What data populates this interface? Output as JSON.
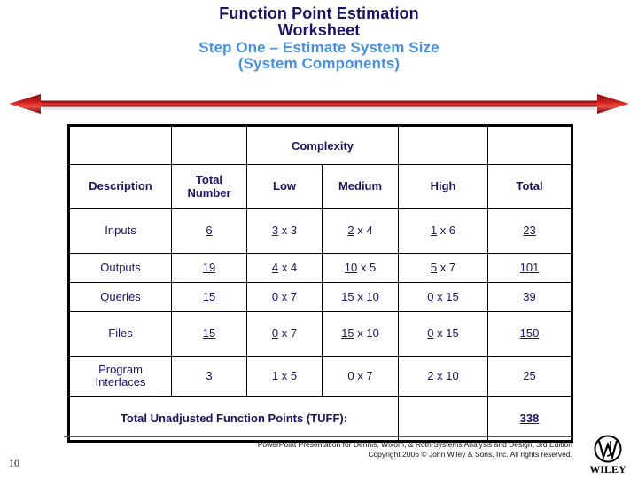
{
  "slide": {
    "title_lines": [
      "Function Point Estimation",
      "Worksheet"
    ],
    "subtitle_lines": [
      "Step One – Estimate System Size",
      "(System Components)"
    ],
    "title_color": "#1b1464",
    "subtitle_color": "#4a90d9",
    "arrow_color": "#a01010",
    "arrow_highlight": "#e02b24",
    "page_number": "10"
  },
  "table": {
    "group_header": "Complexity",
    "columns": [
      "Description",
      "Total\nNumber",
      "Low",
      "Medium",
      "High",
      "Total"
    ],
    "column_headers": {
      "description": "Description",
      "total_number_line1": "Total",
      "total_number_line2": "Number",
      "low": "Low",
      "medium": "Medium",
      "high": "High",
      "total": "Total"
    },
    "rows": [
      {
        "description": "Inputs",
        "total_number": "6",
        "low_value": "3",
        "low_multiplier": "x 3",
        "medium_value": "2",
        "medium_multiplier": "x 4",
        "high_value": "1",
        "high_multiplier": "x 6",
        "total": "23"
      },
      {
        "description": "Outputs",
        "total_number": "19",
        "low_value": "4",
        "low_multiplier": "x 4",
        "medium_value": "10",
        "medium_multiplier": "x 5",
        "high_value": "5",
        "high_multiplier": "x 7",
        "total": "101"
      },
      {
        "description": "Queries",
        "total_number": "15",
        "low_value": "0",
        "low_multiplier": "x 7",
        "medium_value": "15",
        "medium_multiplier": "x 10",
        "high_value": "0",
        "high_multiplier": "x 15",
        "total": "39"
      },
      {
        "description": "Files",
        "total_number": "15",
        "low_value": "0",
        "low_multiplier": "x 7",
        "medium_value": "15",
        "medium_multiplier": "x 10",
        "high_value": "0",
        "high_multiplier": "x 15",
        "total": "150"
      },
      {
        "description_line1": "Program",
        "description_line2": "Interfaces",
        "total_number": "3",
        "low_value": "1",
        "low_multiplier": "x 5",
        "medium_value": "0",
        "medium_multiplier": "x 7",
        "high_value": "2",
        "high_multiplier": "x 10",
        "total": "25"
      }
    ],
    "footer_row": {
      "label": "Total Unadjusted Function Points (TUFF):",
      "high": "",
      "total": "338"
    }
  },
  "footer": {
    "line1": "PowerPoint Presentation for Dennis, Wixom, & Roth Systems Analysis and Design, 3rd Edition",
    "line2": "Copyright 2006 © John Wiley & Sons, Inc.  All rights reserved.",
    "logo_text": "WILEY",
    "logo_monogram": "JW"
  }
}
